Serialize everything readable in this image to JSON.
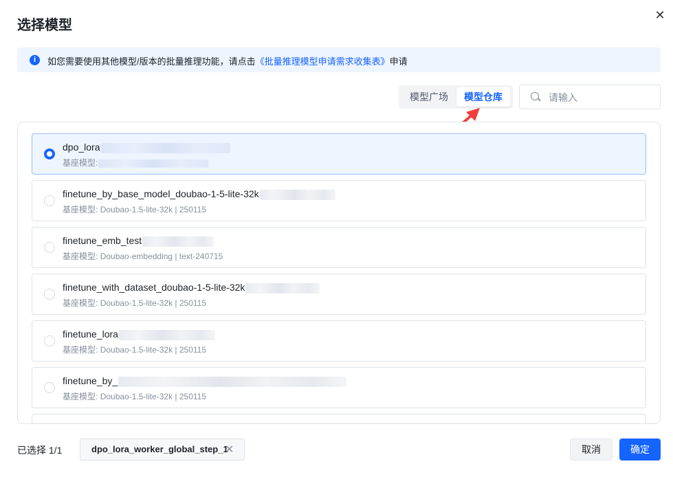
{
  "dialog": {
    "title": "选择模型",
    "close_icon": "close-icon"
  },
  "notice": {
    "icon": "info-icon",
    "icon_glyph": "i",
    "text_before": "如您需要使用其他模型/版本的批量推理功能，请点击",
    "link_text": "《批量推理模型申请需求收集表》",
    "text_after": "申请"
  },
  "tabs": [
    {
      "label": "模型广场",
      "active": false
    },
    {
      "label": "模型仓库",
      "active": true
    }
  ],
  "search": {
    "placeholder": "请输入",
    "value": "",
    "icon": "search-icon"
  },
  "models": [
    {
      "name": "dpo_lora",
      "base_label": "基座模型:",
      "base_value": "",
      "selected": true
    },
    {
      "name": "finetune_by_base_model_doubao-1-5-lite-32k",
      "base_label": "基座模型:",
      "base_value": "Doubao-1.5-lite-32k | 250115",
      "selected": false
    },
    {
      "name": "finetune_emb_test",
      "base_label": "基座模型:",
      "base_value": "Doubao-embedding | text-240715",
      "selected": false
    },
    {
      "name": "finetune_with_dataset_doubao-1-5-lite-32k",
      "base_label": "基座模型:",
      "base_value": "Doubao-1.5-lite-32k | 250115",
      "selected": false
    },
    {
      "name": "finetune_lora",
      "base_label": "基座模型:",
      "base_value": "Doubao-1.5-lite-32k | 250115",
      "selected": false
    },
    {
      "name": "finetune_by_",
      "base_label": "基座模型:",
      "base_value": "Doubao-1.5-lite-32k | 250115",
      "selected": false
    }
  ],
  "footer": {
    "selected_count": "已选择 1/1",
    "selected_tag": "dpo_lora_worker_global_step_1",
    "tag_close_glyph": "✕",
    "cancel_label": "取消",
    "confirm_label": "确定",
    "accent_color": "#1664ff"
  }
}
